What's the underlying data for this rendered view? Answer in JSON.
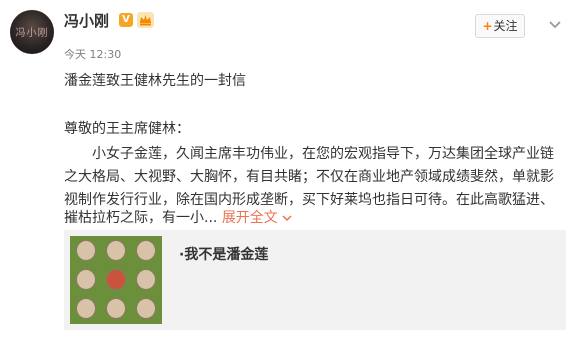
{
  "user": {
    "name": "冯小刚",
    "verified_badge": "V",
    "time": "今天 12:30",
    "follow_label": "关注",
    "follow_icon": "+",
    "avatar_text": "冯小刚"
  },
  "post": {
    "headline": "潘金莲致王健林先生的一封信",
    "salutation": "尊敬的王主席健林：",
    "body_lines": [
      "小女子金莲，久闻主席丰功伟业，在您的宏观指导下，万达集团全球产业链",
      "之大格局、大视野、大胸怀，有目共睹；不仅在商业地产领域成绩斐然，单就影",
      "视制作发行行业，除在国内形成垄断，买下好莱坞也指日可待。在此高歌猛进、",
      "摧枯拉朽之际，有一小..."
    ],
    "expand_label": "展开全文",
    "expand_icon": "chevron-down-icon"
  },
  "card": {
    "title": "·我不是潘金莲"
  },
  "colors": {
    "accent": "#eb7350",
    "orange": "#ff8200",
    "badge": "#f5a623"
  }
}
